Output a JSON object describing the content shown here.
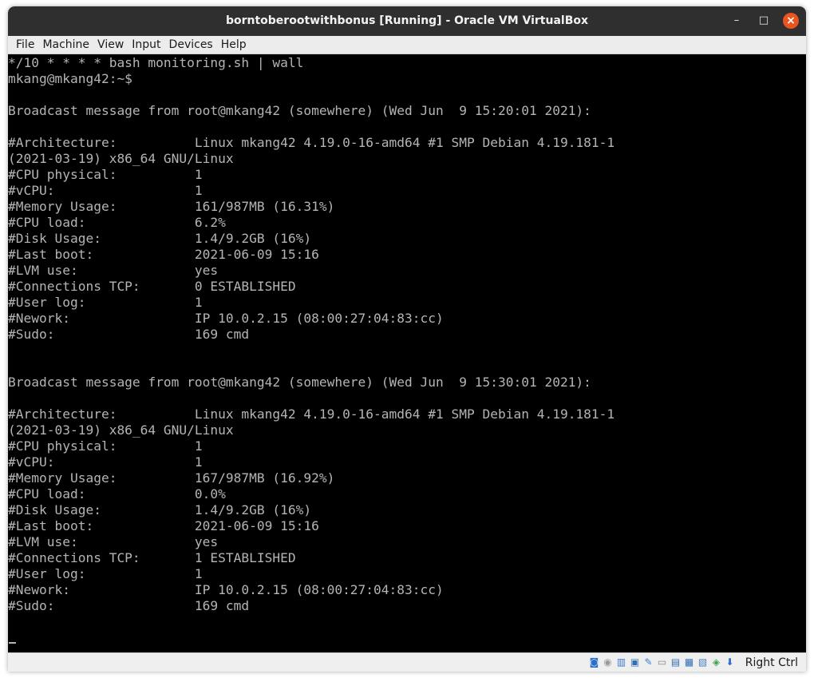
{
  "window": {
    "title": "borntoberootwithbonus [Running] - Oracle VM VirtualBox",
    "controls": {
      "minimize": "–",
      "maximize": "□",
      "close": "×"
    }
  },
  "menubar": {
    "items": [
      "File",
      "Machine",
      "View",
      "Input",
      "Devices",
      "Help"
    ]
  },
  "terminal": {
    "lines": [
      "*/10 * * * * bash monitoring.sh | wall",
      "mkang@mkang42:~$",
      "",
      "Broadcast message from root@mkang42 (somewhere) (Wed Jun  9 15:20:01 2021):",
      "",
      "#Architecture:          Linux mkang42 4.19.0-16-amd64 #1 SMP Debian 4.19.181-1",
      "(2021-03-19) x86_64 GNU/Linux",
      "#CPU physical:          1",
      "#vCPU:                  1",
      "#Memory Usage:          161/987MB (16.31%)",
      "#CPU load:              6.2%",
      "#Disk Usage:            1.4/9.2GB (16%)",
      "#Last boot:             2021-06-09 15:16",
      "#LVM use:               yes",
      "#Connections TCP:       0 ESTABLISHED",
      "#User log:              1",
      "#Nework:                IP 10.0.2.15 (08:00:27:04:83:cc)",
      "#Sudo:                  169 cmd",
      "",
      "",
      "Broadcast message from root@mkang42 (somewhere) (Wed Jun  9 15:30:01 2021):",
      "",
      "#Architecture:          Linux mkang42 4.19.0-16-amd64 #1 SMP Debian 4.19.181-1",
      "(2021-03-19) x86_64 GNU/Linux",
      "#CPU physical:          1",
      "#vCPU:                  1",
      "#Memory Usage:          167/987MB (16.92%)",
      "#CPU load:              0.0%",
      "#Disk Usage:            1.4/9.2GB (16%)",
      "#Last boot:             2021-06-09 15:16",
      "#LVM use:               yes",
      "#Connections TCP:       1 ESTABLISHED",
      "#User log:              1",
      "#Nework:                IP 10.0.2.15 (08:00:27:04:83:cc)",
      "#Sudo:                  169 cmd"
    ]
  },
  "statusbar": {
    "host_key": "Right Ctrl",
    "icons": [
      {
        "name": "hard-disk-icon",
        "glyph": "◙",
        "color": "#2a6fc9"
      },
      {
        "name": "optical-drive-icon",
        "glyph": "◉",
        "color": "#9a9a9a"
      },
      {
        "name": "audio-icon",
        "glyph": "▥",
        "color": "#3a78c8"
      },
      {
        "name": "network-icon",
        "glyph": "▣",
        "color": "#2f6fb8"
      },
      {
        "name": "usb-icon",
        "glyph": "✎",
        "color": "#3b82d0"
      },
      {
        "name": "shared-folders-icon",
        "glyph": "▭",
        "color": "#8a8a8a"
      },
      {
        "name": "display-icon",
        "glyph": "▤",
        "color": "#2f6fb8"
      },
      {
        "name": "video-capture-icon",
        "glyph": "▦",
        "color": "#2f6fb8"
      },
      {
        "name": "cpu-icon",
        "glyph": "▧",
        "color": "#4a7fc0"
      },
      {
        "name": "guest-additions-icon",
        "glyph": "◈",
        "color": "#3aa34a"
      },
      {
        "name": "mouse-integration-icon",
        "glyph": "⬇",
        "color": "#2a6fc9"
      }
    ]
  }
}
